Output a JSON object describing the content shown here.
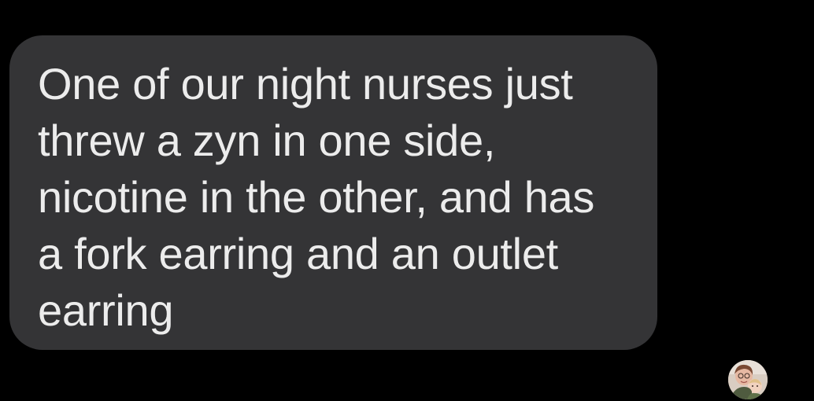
{
  "message": {
    "lines": [
      "One of our night nurses just",
      "threw a zyn in one side,",
      "nicotine in the other, and has",
      "a fork earring and an outlet",
      "earring"
    ]
  },
  "avatar": {
    "icon": "contact-photo"
  },
  "colors": {
    "background": "#000000",
    "bubble": "#343436",
    "text": "#ececec"
  }
}
